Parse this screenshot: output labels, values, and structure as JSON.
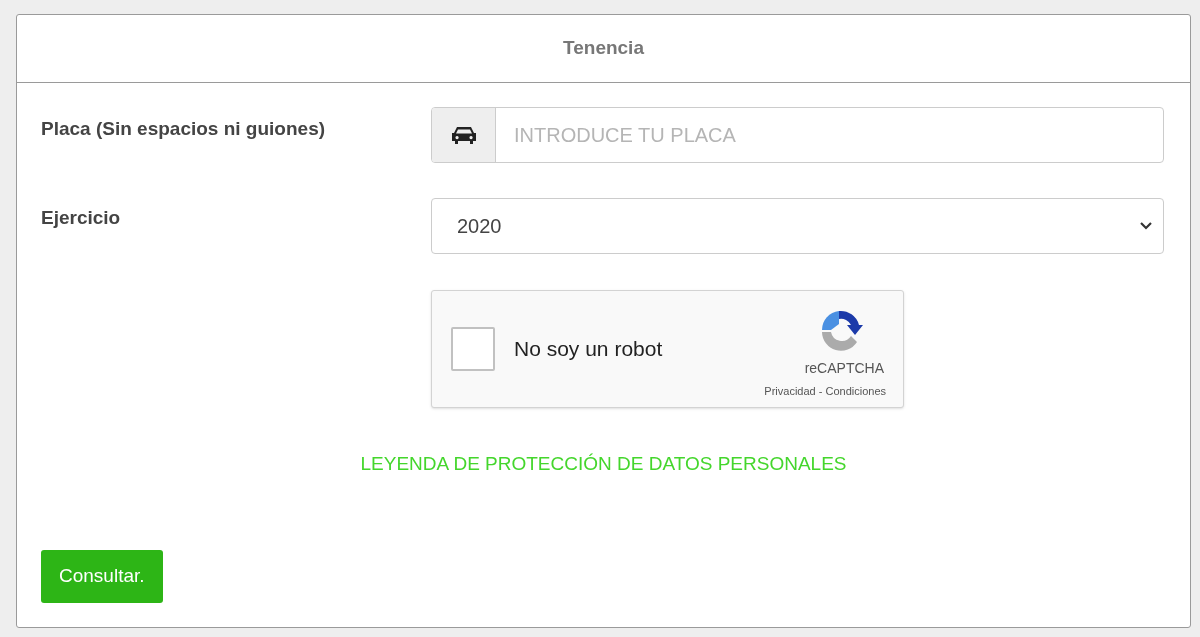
{
  "panel": {
    "title": "Tenencia"
  },
  "plate": {
    "label": "Placa (Sin espacios ni guiones)",
    "placeholder": "INTRODUCE TU PLACA"
  },
  "year": {
    "label": "Ejercicio",
    "value": "2020"
  },
  "captcha": {
    "checked": false,
    "label": "No soy un robot",
    "brand": "reCAPTCHA",
    "links": "Privacidad - Condiciones"
  },
  "privacy_link": "LEYENDA DE PROTECCIÓN DE DATOS PERSONALES",
  "submit_button": "Consultar."
}
